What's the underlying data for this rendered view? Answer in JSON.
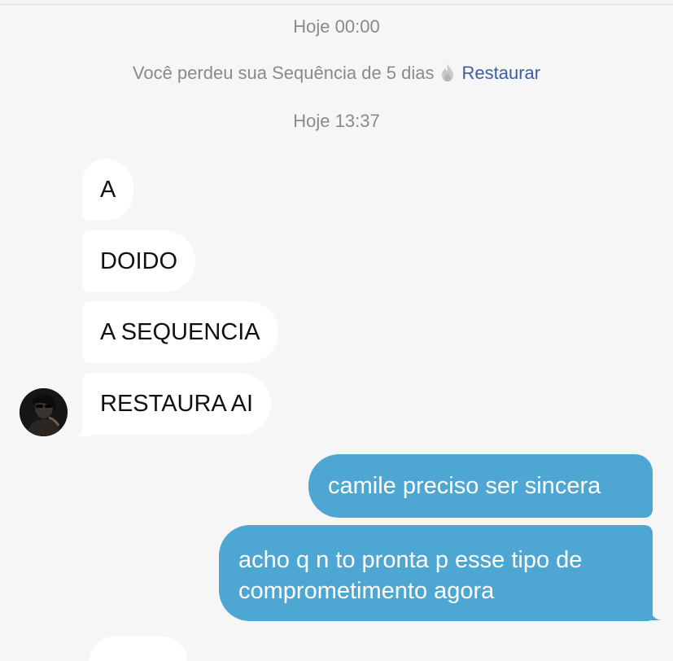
{
  "chat": {
    "timestamp_1": "Hoje 00:00",
    "streak_notice": {
      "text": "Você perdeu sua Sequência de 5 dias",
      "action_label": "Restaurar",
      "icon": "flame-icon",
      "action_color": "#3b5ea8"
    },
    "timestamp_2": "Hoje 13:37",
    "incoming_messages": [
      {
        "text": "A"
      },
      {
        "text": "DOIDO"
      },
      {
        "text": "A SEQUENCIA"
      },
      {
        "text": "RESTAURA AI"
      }
    ],
    "outgoing_messages": [
      {
        "text": "camile preciso ser sincera"
      },
      {
        "text": "acho q n to pronta p esse tipo de comprometimento agora"
      }
    ]
  },
  "colors": {
    "background": "#f6f6f6",
    "incoming_bubble": "#ffffff",
    "outgoing_bubble": "#4ea6d2",
    "meta_text": "#8a8a8e"
  }
}
